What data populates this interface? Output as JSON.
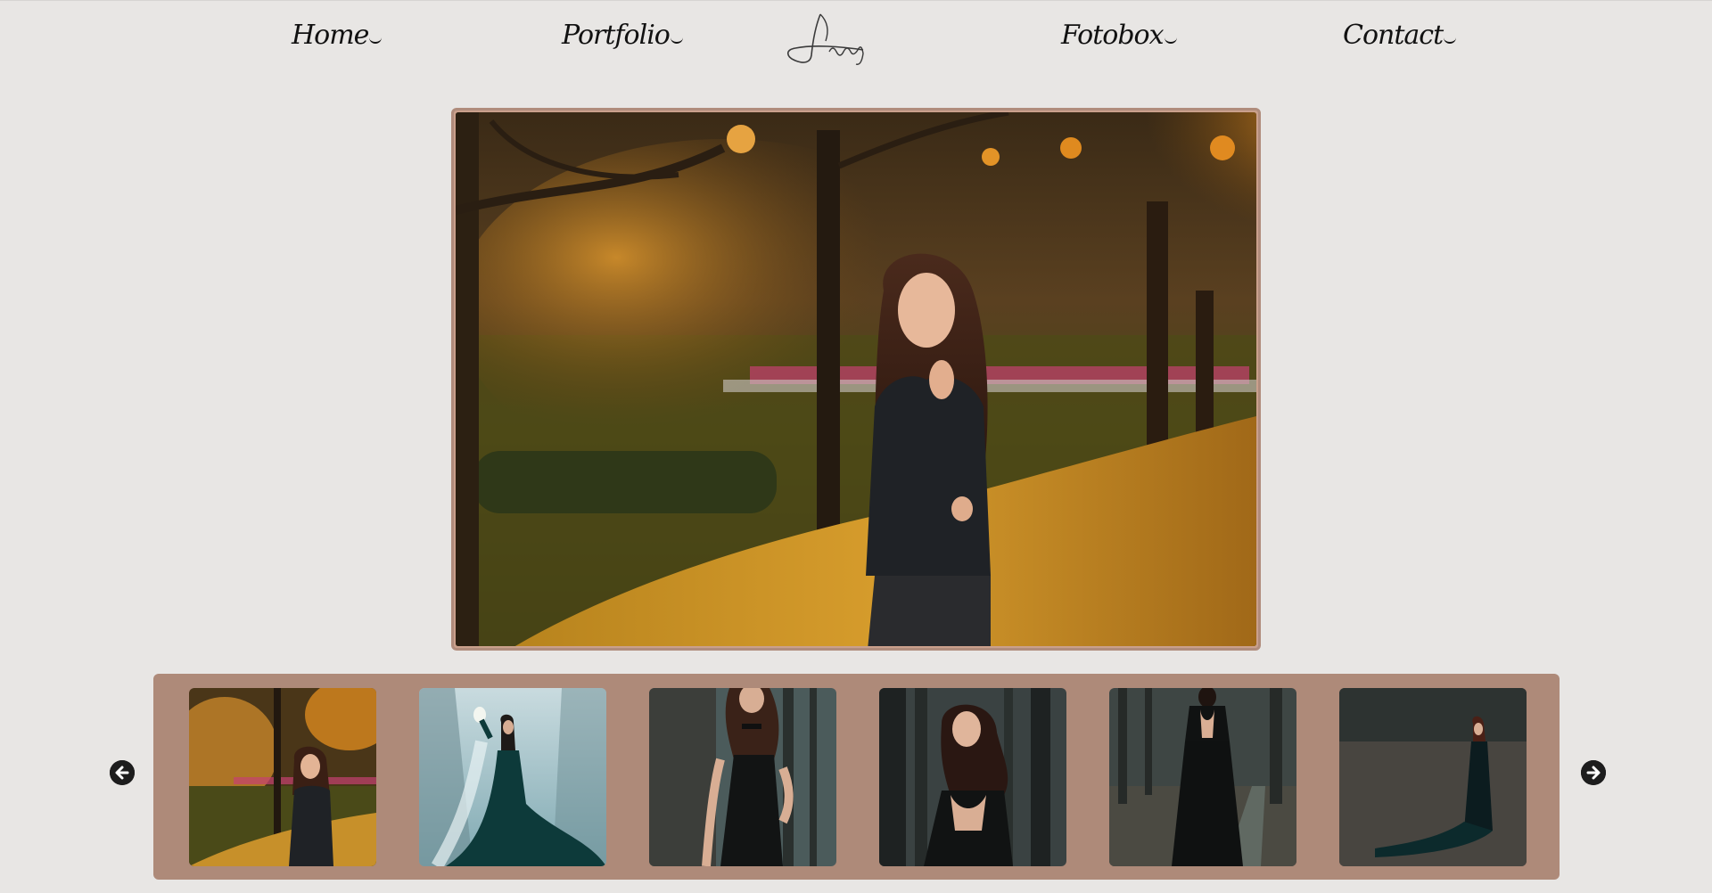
{
  "nav": {
    "items": [
      {
        "label": "Home"
      },
      {
        "label": "Portfolio"
      },
      {
        "label": "Fotobox"
      },
      {
        "label": "Contact"
      }
    ],
    "logo_text": "Ivanyp"
  },
  "gallery": {
    "main_photo": "autumn-portrait-woman-leather-jacket",
    "thumbnails": [
      {
        "subject": "autumn-park-portrait"
      },
      {
        "subject": "winter-forest-green-gown-lantern"
      },
      {
        "subject": "black-dress-by-tree"
      },
      {
        "subject": "forest-backless-dress-smile"
      },
      {
        "subject": "forest-path-backless-gown"
      },
      {
        "subject": "forest-long-train-gown"
      }
    ],
    "prev_icon": "arrow-left-circle-icon",
    "next_icon": "arrow-right-circle-icon"
  },
  "colors": {
    "background": "#e8e6e4",
    "strip": "#ae8a79",
    "frame_border": "#b08c7c",
    "text": "#111111"
  }
}
